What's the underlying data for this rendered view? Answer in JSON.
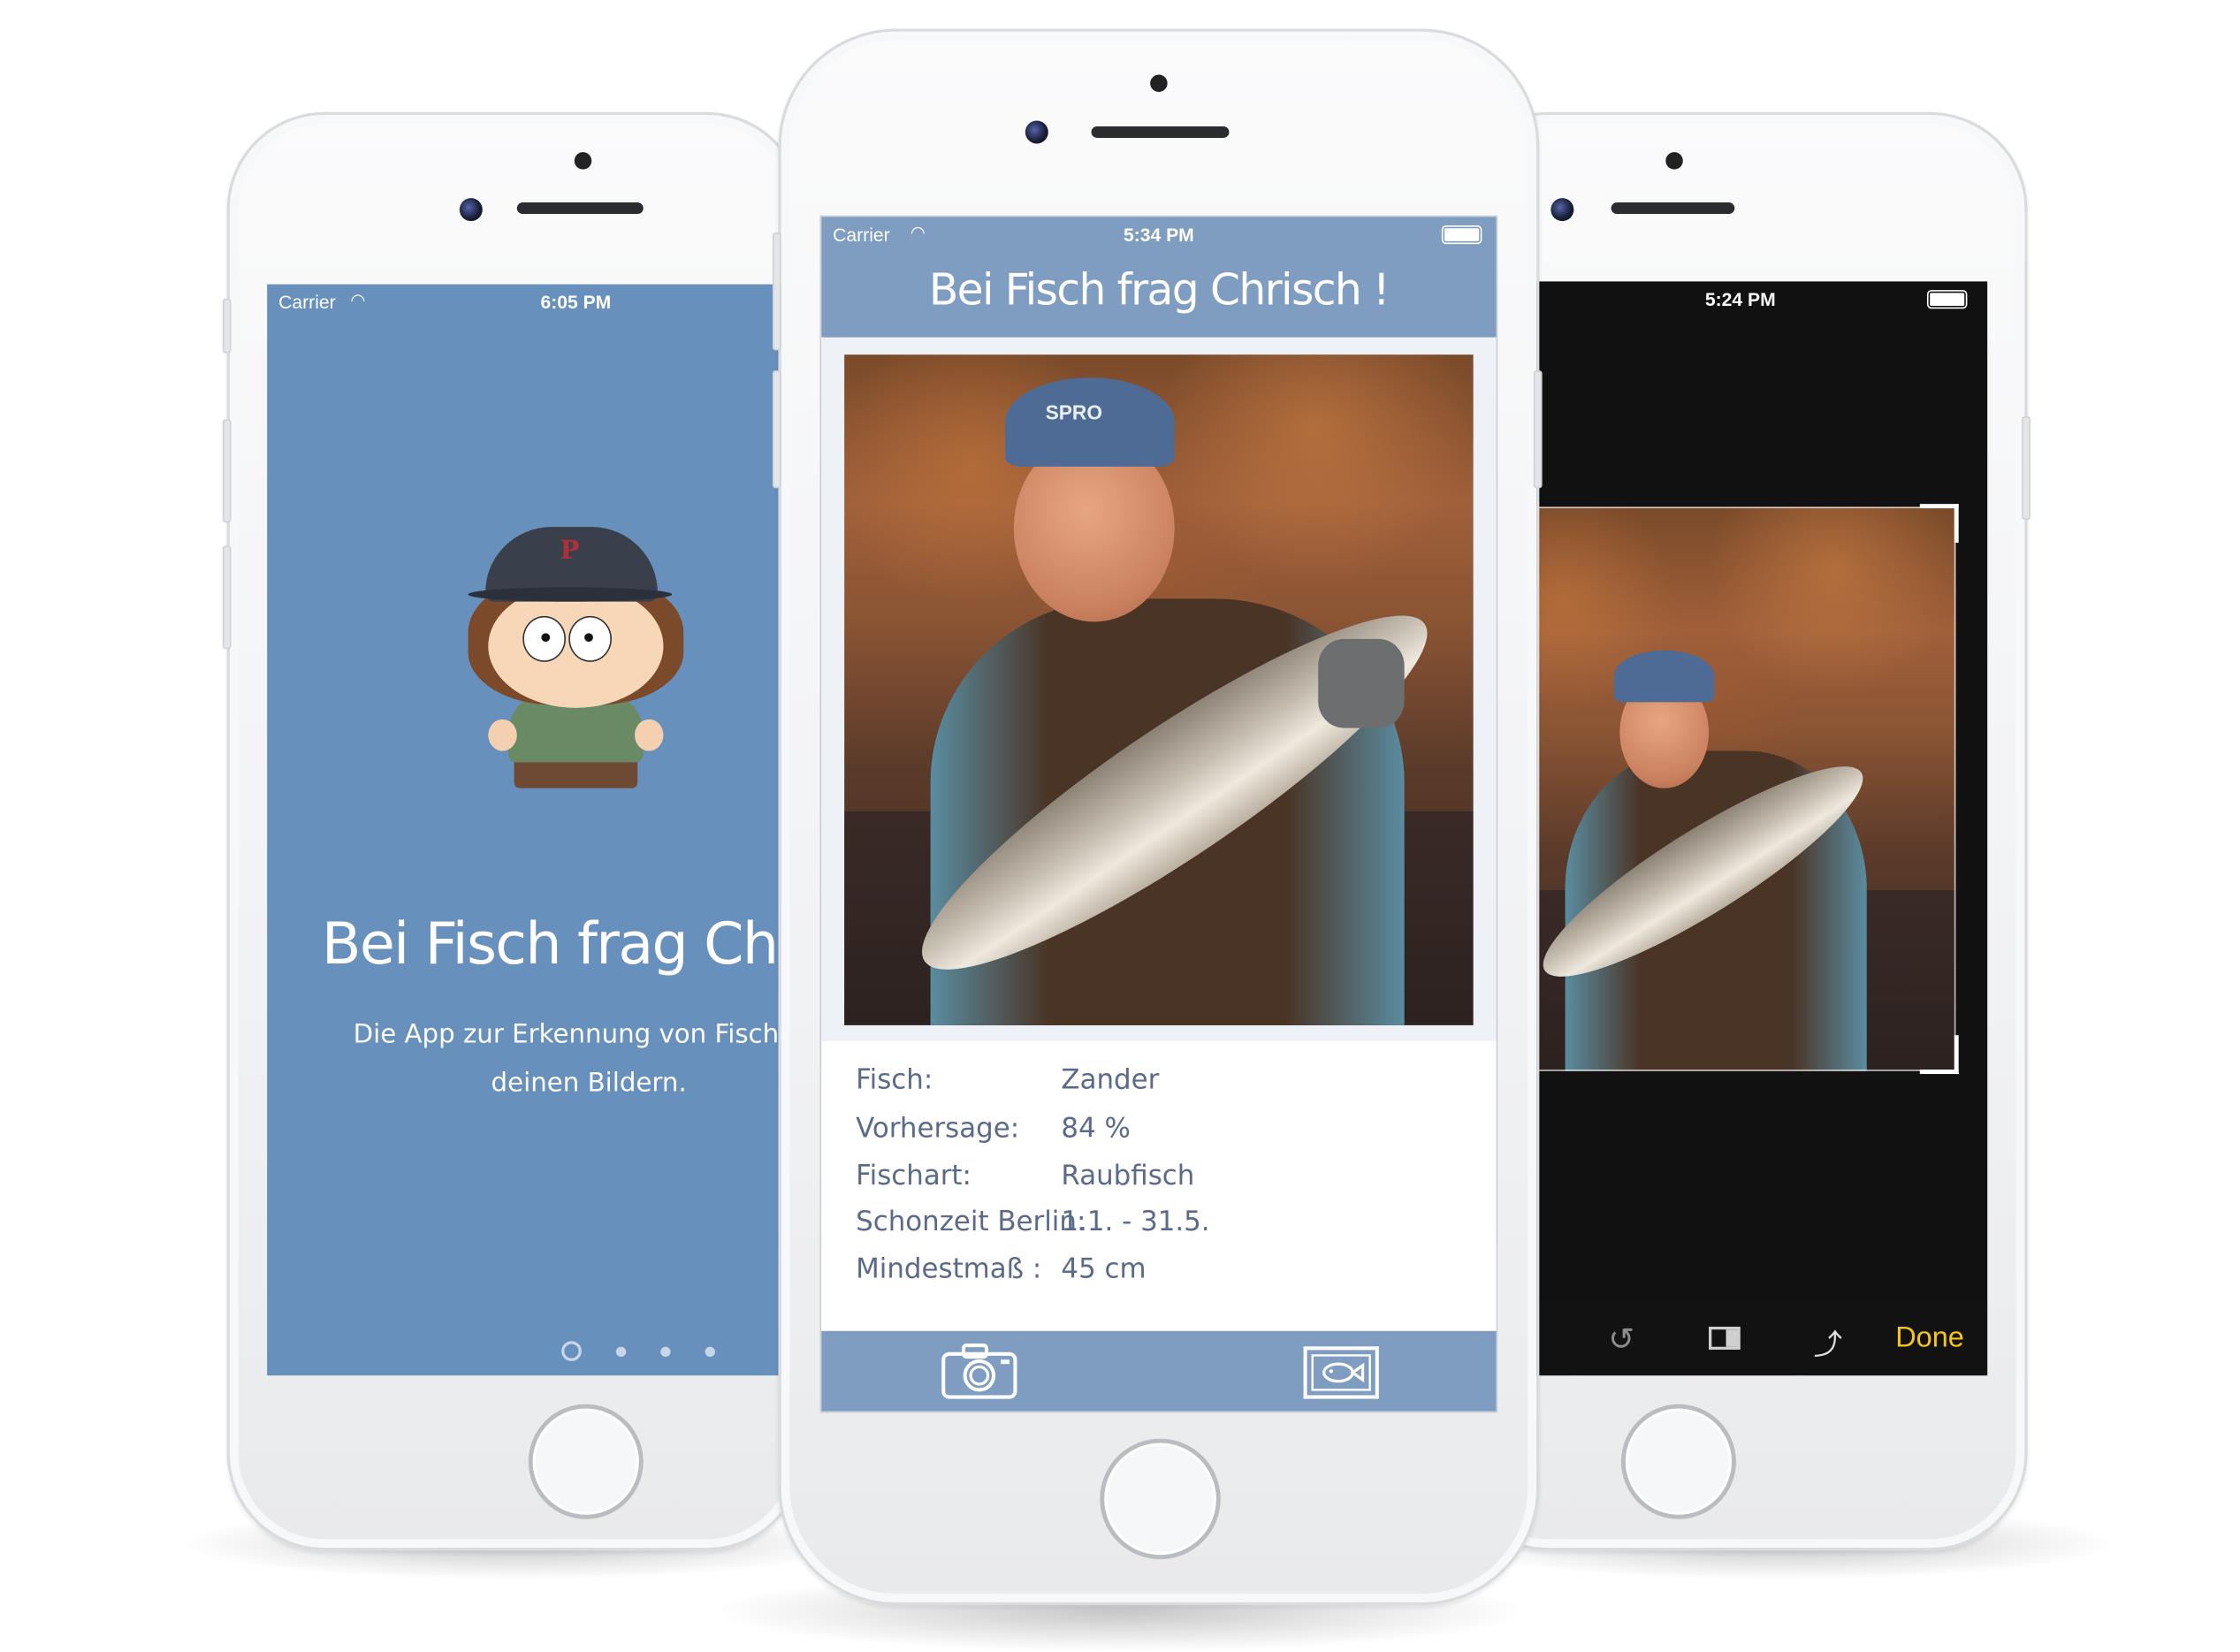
{
  "left_phone": {
    "status": {
      "carrier": "Carrier",
      "time": "6:05 PM"
    },
    "title": "Bei Fisch frag Chrisc",
    "subtitle_line1": "Die App zur Erkennung von Fischen au",
    "subtitle_line2": "deinen Bildern.",
    "bg_color": "#6790bd",
    "page_dots": 4,
    "active_page": 1
  },
  "center_phone": {
    "status": {
      "carrier": "Carrier",
      "time": "5:34 PM"
    },
    "header_title": "Bei Fisch frag Chrisch !",
    "header_color": "#7f9dc1",
    "info": [
      {
        "label": "Fisch:",
        "value": "Zander"
      },
      {
        "label": "Vorhersage:",
        "value": "84 %"
      },
      {
        "label": "Fischart:",
        "value": "Raubfisch"
      },
      {
        "label": "Schonzeit Berlin:",
        "value": "1.1. - 31.5."
      },
      {
        "label": "Mindestmaß :",
        "value": "45 cm"
      }
    ],
    "toolbar": {
      "camera_icon": "camera-icon",
      "gallery_icon": "fish-picture-icon"
    }
  },
  "right_phone": {
    "status": {
      "time": "5:24 PM"
    },
    "toolbar": {
      "rotate_icon": "undo-rotate-icon",
      "aspect_icon": "aspect-ratio-icon",
      "rotate90_icon": "rotate-90-icon",
      "done_label": "Done"
    },
    "done_color": "#f5c518"
  }
}
